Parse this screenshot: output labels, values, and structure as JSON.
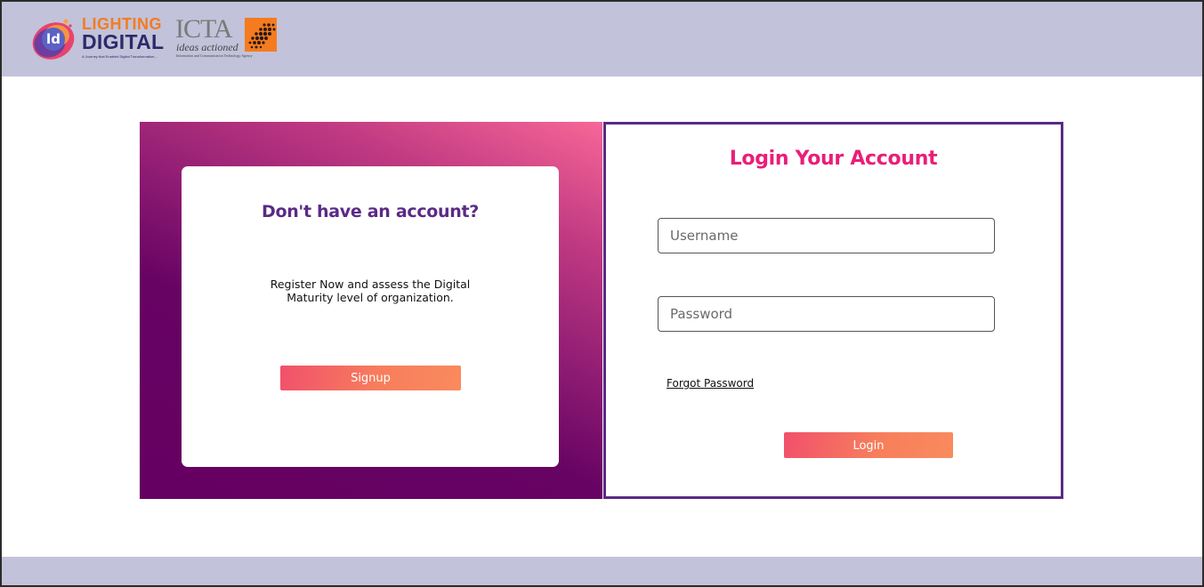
{
  "header": {
    "logo_lighting_digital": {
      "line1": "LIGHTING",
      "line2": "DIGITAL",
      "tagline": "A Journey that Enabled Digital Transformation...",
      "icon": "ld-logo-icon"
    },
    "logo_icta": {
      "title": "ICTA",
      "tagline": "ideas actioned",
      "subtitle": "Information and Communication Technology Agency",
      "icon": "icta-dots-icon"
    }
  },
  "signup_card": {
    "heading": "Don't have an account?",
    "description": "Register Now and assess the Digital Maturity level of organization.",
    "button_label": "Signup"
  },
  "login_form": {
    "heading": "Login Your Account",
    "username_placeholder": "Username",
    "username_value": "",
    "password_placeholder": "Password",
    "password_value": "",
    "forgot_password_label": "Forgot Password",
    "button_label": "Login"
  },
  "colors": {
    "header_bg": "#c2c2da",
    "brand_purple": "#5b2a86",
    "brand_pink": "#e91e78",
    "button_start": "#f1506c",
    "button_end": "#fa8a5e",
    "panel_dark": "#650062"
  }
}
